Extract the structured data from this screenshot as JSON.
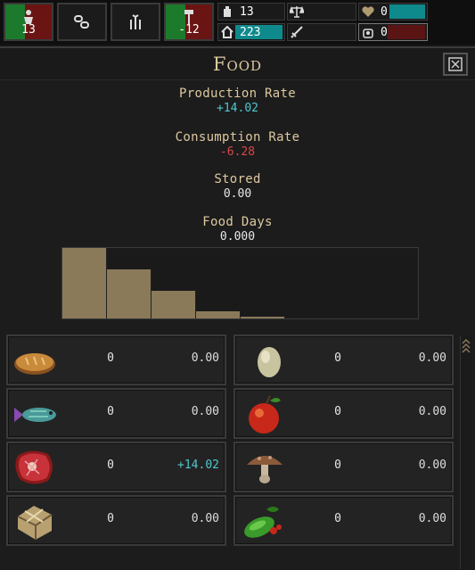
{
  "topbar": {
    "buttons": [
      {
        "icon": "person-icon",
        "value": "13",
        "colored": true
      },
      {
        "icon": "chain-icon",
        "value": "",
        "colored": false
      },
      {
        "icon": "wheat-icon",
        "value": "",
        "colored": false
      },
      {
        "icon": "hammer-icon",
        "value": "-12",
        "colored": true
      }
    ],
    "stats": {
      "population": "13",
      "housing": "223",
      "justice": "",
      "military": "",
      "health": "0",
      "happiness": "0"
    }
  },
  "panel": {
    "title": "Food",
    "close_icon": "close-icon"
  },
  "metrics": {
    "production_label": "Production Rate",
    "production_value": "+14.02",
    "consumption_label": "Consumption Rate",
    "consumption_value": "-6.28",
    "stored_label": "Stored",
    "stored_value": "0.00",
    "days_label": "Food Days",
    "days_value": "0.000"
  },
  "histogram": {
    "values": [
      1.0,
      0.69,
      0.39,
      0.1,
      0.03
    ]
  },
  "foods": [
    {
      "name": "bread-icon",
      "amount": "0",
      "rate": "0.00",
      "rate_kind": "neu"
    },
    {
      "name": "egg-icon",
      "amount": "0",
      "rate": "0.00",
      "rate_kind": "neu"
    },
    {
      "name": "fish-icon",
      "amount": "0",
      "rate": "0.00",
      "rate_kind": "neu"
    },
    {
      "name": "apple-icon",
      "amount": "0",
      "rate": "0.00",
      "rate_kind": "neu"
    },
    {
      "name": "meat-icon",
      "amount": "0",
      "rate": "+14.02",
      "rate_kind": "pos"
    },
    {
      "name": "mushroom-icon",
      "amount": "0",
      "rate": "0.00",
      "rate_kind": "neu"
    },
    {
      "name": "package-icon",
      "amount": "0",
      "rate": "0.00",
      "rate_kind": "neu"
    },
    {
      "name": "vegetables-icon",
      "amount": "0",
      "rate": "0.00",
      "rate_kind": "neu"
    }
  ],
  "colors": {
    "accent_text": "#ddc9a0",
    "positive": "#4fc8d2",
    "negative": "#d84848",
    "bar": "#8a7a5a",
    "teal_fill": "#0f8a8c",
    "red_fill": "#5a1414"
  }
}
